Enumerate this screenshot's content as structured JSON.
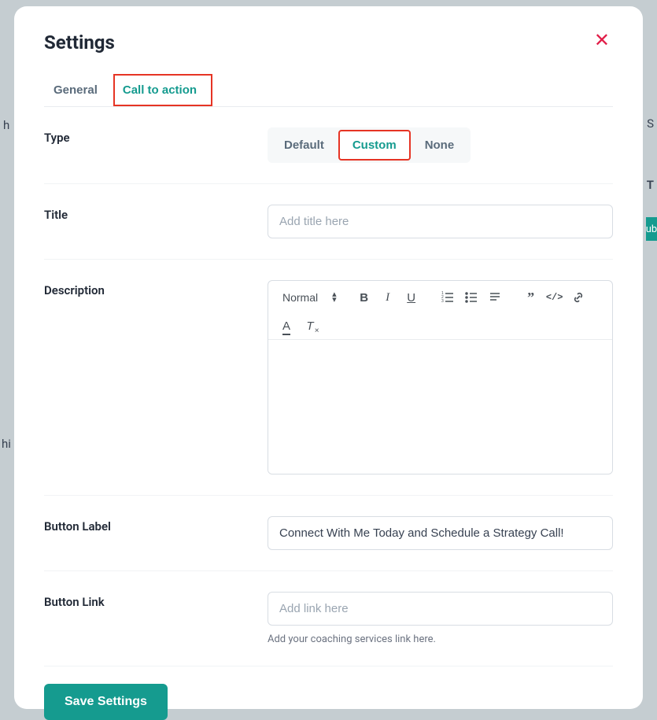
{
  "modal": {
    "title": "Settings",
    "close_label": "✕"
  },
  "tabs": {
    "general": "General",
    "cta": "Call to action"
  },
  "type_section": {
    "label": "Type",
    "options": {
      "default": "Default",
      "custom": "Custom",
      "none": "None"
    },
    "selected": "custom"
  },
  "title_section": {
    "label": "Title",
    "placeholder": "Add title here",
    "value": ""
  },
  "description_section": {
    "label": "Description",
    "format_label": "Normal",
    "value": ""
  },
  "button_label_section": {
    "label": "Button Label",
    "value": "Connect With Me Today and Schedule a Strategy Call!"
  },
  "button_link_section": {
    "label": "Button Link",
    "placeholder": "Add link here",
    "value": "",
    "helper": "Add your coaching services link here."
  },
  "footer": {
    "save_label": "Save Settings"
  },
  "background_hints": {
    "h": "h",
    "hi": "hi",
    "s": "S",
    "t": "T",
    "ub": "ub"
  }
}
